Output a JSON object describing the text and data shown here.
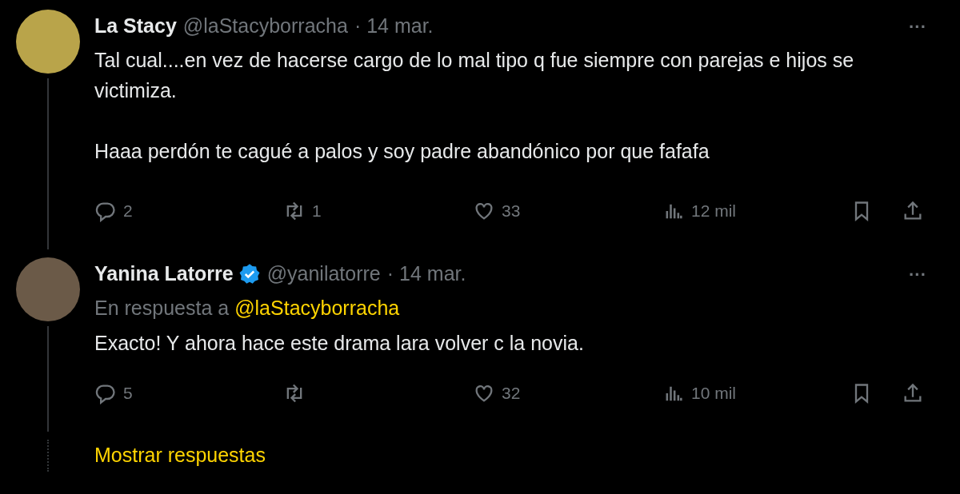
{
  "tweets": [
    {
      "name": "La Stacy",
      "verified": false,
      "handle": "@laStacyborracha",
      "date": "· 14 mar.",
      "text": "Tal cual....en vez de hacerse cargo de lo mal tipo q fue siempre con parejas e hijos se victimiza.\n\nHaaa perdón te cagué a palos y soy padre abandónico por que fafafa",
      "more": "···",
      "replies": "2",
      "retweets": "1",
      "likes": "33",
      "views": "12 mil"
    },
    {
      "name": "Yanina Latorre",
      "verified": true,
      "handle": "@yanilatorre",
      "date": "· 14 mar.",
      "reply_to_label": "En respuesta a",
      "reply_to_handle": "@laStacyborracha",
      "text": "Exacto! Y ahora hace este drama lara volver c la novia.",
      "more": "···",
      "replies": "5",
      "likes": "32",
      "views": "10 mil"
    }
  ],
  "show_replies": "Mostrar respuestas"
}
